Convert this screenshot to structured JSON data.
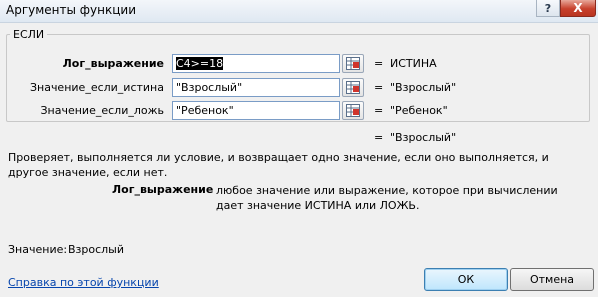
{
  "window": {
    "title": "Аргументы функции",
    "help_label": "?",
    "close_label": "X"
  },
  "function": {
    "name": "ЕСЛИ"
  },
  "arguments": [
    {
      "label": "Лог_выражение",
      "value": "C4>=18",
      "result": "ИСТИНА",
      "bold": true
    },
    {
      "label": "Значение_если_истина",
      "value": "\"Взрослый\"",
      "result": "\"Взрослый\"",
      "bold": false
    },
    {
      "label": "Значение_если_ложь",
      "value": "\"Ребенок\"",
      "result": "\"Ребенок\"",
      "bold": false
    }
  ],
  "equals_sign": "=",
  "overall_result": "\"Взрослый\"",
  "description": "Проверяет, выполняется ли условие, и возвращает одно значение, если оно выполняется, и другое значение, если нет.",
  "param_help": {
    "name": "Лог_выражение",
    "text": "любое значение или выражение, которое при вычислении дает значение ИСТИНА или ЛОЖЬ."
  },
  "value_row": {
    "label": "Значение:",
    "value": "Взрослый"
  },
  "help_link": "Справка по этой функции",
  "buttons": {
    "ok": "ОК",
    "cancel": "Отмена"
  },
  "icons": {
    "collapse": "range-select-icon",
    "close": "close-icon",
    "help": "help-icon"
  }
}
